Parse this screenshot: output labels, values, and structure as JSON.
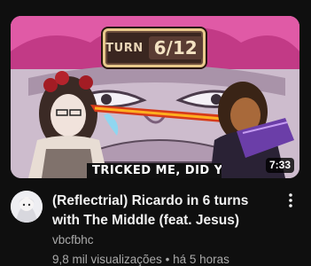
{
  "video": {
    "thumbnail": {
      "turn_label": "TURN",
      "turn_value": "6/12",
      "caption": "TRICKED ME, DID YO",
      "duration": "7:33",
      "icon": "video-thumbnail"
    },
    "title": "(Reflectrial) Ricardo in 6 turns with The Middle (feat. Jesus)",
    "channel": "vbcfbhc",
    "views": "9,8 mil visualizações",
    "separator": "•",
    "age": "há 5 horas",
    "menu_icon": "more-vert-icon",
    "avatar_icon": "channel-avatar"
  },
  "colors": {
    "background": "#0f0f0f",
    "primary_text": "#f1f1f1",
    "secondary_text": "#aaaaaa"
  }
}
